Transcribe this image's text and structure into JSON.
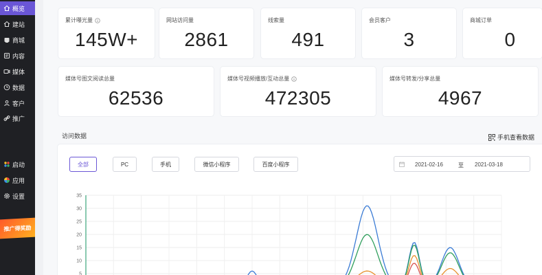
{
  "sidebar": {
    "items": [
      {
        "label": "概览",
        "icon": "home-icon"
      },
      {
        "label": "建站",
        "icon": "home-icon"
      },
      {
        "label": "商城",
        "icon": "store-icon"
      },
      {
        "label": "内容",
        "icon": "content-icon"
      },
      {
        "label": "媒体",
        "icon": "video-icon"
      },
      {
        "label": "数据",
        "icon": "clock-icon"
      },
      {
        "label": "客户",
        "icon": "user-icon"
      },
      {
        "label": "推广",
        "icon": "link-icon"
      }
    ],
    "bottom_items": [
      {
        "label": "启动",
        "icon": "launch-icon"
      },
      {
        "label": "应用",
        "icon": "apps-icon"
      },
      {
        "label": "设置",
        "icon": "gear-icon"
      }
    ],
    "promo_text": "推广得奖励"
  },
  "stats_row1": [
    {
      "label": "累计曝光量",
      "value": "145W+",
      "has_info": true
    },
    {
      "label": "网站访问量",
      "value": "2861",
      "has_info": false
    },
    {
      "label": "线索量",
      "value": "491",
      "has_info": false
    },
    {
      "label": "会员客户",
      "value": "3",
      "has_info": false
    },
    {
      "label": "商城订单",
      "value": "0",
      "has_info": false
    }
  ],
  "stats_row2": [
    {
      "label": "媒体号图文阅读总量",
      "value": "62536",
      "has_info": false
    },
    {
      "label": "媒体号视频播放/互动总量",
      "value": "472305",
      "has_info": true
    },
    {
      "label": "媒体号转发/分享总量",
      "value": "4967",
      "has_info": false
    }
  ],
  "visits": {
    "title": "访问数据",
    "qr_label": "手机查看数据",
    "filters": [
      "全部",
      "PC",
      "手机",
      "微信小程序",
      "百度小程序"
    ],
    "active_filter": "全部",
    "date_start": "2021-02-16",
    "date_sep": "至",
    "date_end": "2021-03-18"
  },
  "chart_data": {
    "type": "line",
    "y_ticks": [
      "35",
      "30",
      "25",
      "20",
      "15",
      "10",
      "5"
    ],
    "ylim": [
      0,
      35
    ],
    "x_count": 31,
    "grid": true,
    "series": [
      {
        "color": "#3a7bd5",
        "values": [
          0,
          0,
          0,
          0,
          0,
          0,
          0,
          0,
          0,
          0,
          0,
          0,
          0,
          0,
          0,
          0,
          0,
          0,
          0,
          0,
          0,
          0,
          0,
          0,
          0,
          0,
          0,
          0,
          0,
          0,
          0
        ]
      },
      {
        "color": "#2e9e5b",
        "values": [
          0,
          0,
          0,
          0,
          0,
          0,
          0,
          0,
          0,
          0,
          0,
          0,
          0,
          0,
          0,
          0,
          0,
          0,
          0,
          0,
          0,
          0,
          0,
          0,
          0,
          0,
          0,
          0,
          0,
          0,
          0
        ]
      },
      {
        "color": "#e8912e",
        "values": [
          0,
          0,
          0,
          0,
          0,
          0,
          0,
          0,
          0,
          0,
          0,
          0,
          0,
          0,
          0,
          0,
          0,
          0,
          0,
          0,
          0,
          0,
          0,
          0,
          0,
          0,
          0,
          0,
          0,
          0,
          0
        ]
      },
      {
        "color": "#d9534f",
        "values": [
          0,
          0,
          0,
          0,
          0,
          0,
          0,
          0,
          0,
          0,
          0,
          0,
          0,
          0,
          0,
          0,
          0,
          0,
          0,
          0,
          0,
          0,
          0,
          0,
          0,
          0,
          0,
          0,
          0,
          0,
          0
        ]
      }
    ],
    "peaks": [
      {
        "center": 12,
        "width": 0.55,
        "values": [
          6,
          0,
          0,
          0
        ]
      },
      {
        "center": 20.3,
        "width": 1.1,
        "values": [
          31,
          20,
          6,
          4
        ]
      },
      {
        "center": 23.7,
        "width": 0.55,
        "values": [
          17,
          16,
          12,
          9
        ]
      },
      {
        "center": 26.3,
        "width": 0.9,
        "values": [
          15,
          13,
          7,
          3
        ]
      }
    ]
  }
}
